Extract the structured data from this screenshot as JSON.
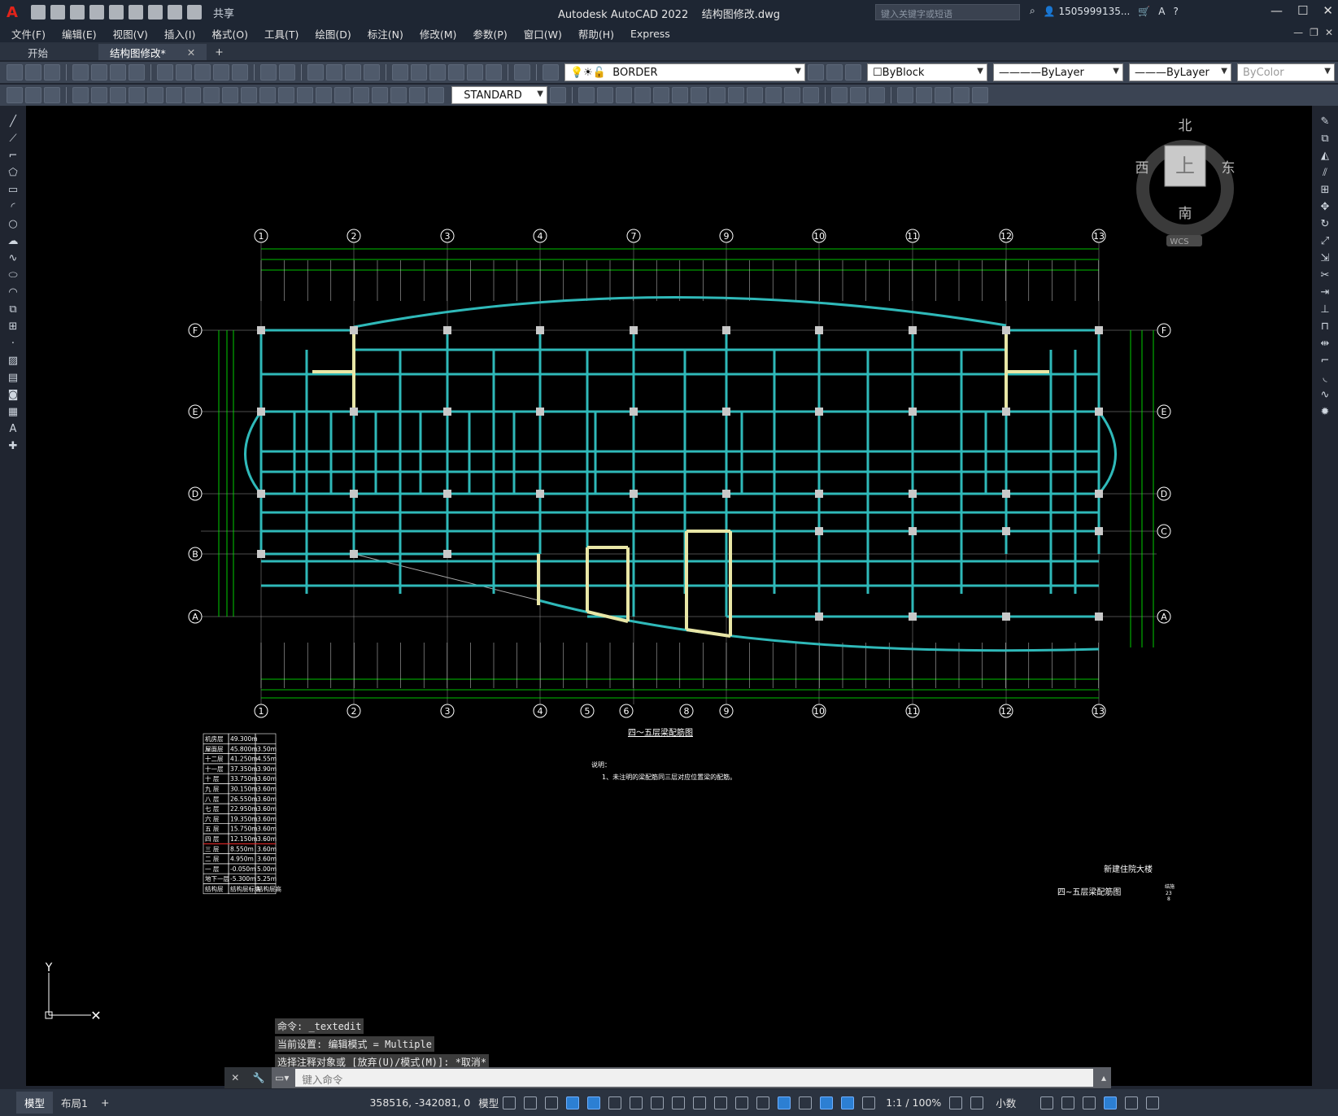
{
  "title": {
    "app_name": "Autodesk AutoCAD 2022",
    "file": "结构图修改.dwg",
    "share": "共享",
    "search_placeholder": "键入关键字或短语",
    "user": "1505999135..."
  },
  "menu": [
    "文件(F)",
    "编辑(E)",
    "视图(V)",
    "插入(I)",
    "格式(O)",
    "工具(T)",
    "绘图(D)",
    "标注(N)",
    "修改(M)",
    "参数(P)",
    "窗口(W)",
    "帮助(H)",
    "Express"
  ],
  "tabs": {
    "start": "开始",
    "active": "结构图修改*",
    "add": "+"
  },
  "toolbar1": {
    "layer": "BORDER",
    "color": "ByBlock",
    "linetype": "ByLayer",
    "lineweight": "ByLayer",
    "plotstyle": "ByColor"
  },
  "toolbar2": {
    "textstyle": "STANDARD"
  },
  "viewcube": {
    "north": "北",
    "south": "南",
    "east": "东",
    "west": "西",
    "top": "上",
    "wcs": "WCS"
  },
  "ucs": {
    "y": "Y"
  },
  "drawing": {
    "top_axes": [
      "1",
      "2",
      "3",
      "4",
      "7",
      "9",
      "10",
      "11",
      "12",
      "13"
    ],
    "bottom_axes": [
      "1",
      "2",
      "3",
      "4",
      "5",
      "6",
      "8",
      "9",
      "10",
      "11",
      "12",
      "13"
    ],
    "left_rows": [
      "F",
      "E",
      "D",
      "B",
      "A"
    ],
    "right_rows": [
      "F",
      "E",
      "D",
      "C",
      "A"
    ],
    "title": "四～五层梁配筋图",
    "note_head": "说明：",
    "note_1": "1、未注明的梁配筋同三层对应位置梁的配筋。",
    "project": "新建住院大楼",
    "sheet": "四~五层梁配筋图",
    "sheet_code": "结施",
    "sheet_no_a": "23",
    "sheet_no_b": "8"
  },
  "floor_table": [
    [
      "机房层",
      "49.300m",
      ""
    ],
    [
      "屋面层",
      "45.800m",
      "3.50m"
    ],
    [
      "十二层",
      "41.250m",
      "4.55m"
    ],
    [
      "十一层",
      "37.350m",
      "3.90m"
    ],
    [
      "十 层",
      "33.750m",
      "3.60m"
    ],
    [
      "九 层",
      "30.150m",
      "3.60m"
    ],
    [
      "八 层",
      "26.550m",
      "3.60m"
    ],
    [
      "七 层",
      "22.950m",
      "3.60m"
    ],
    [
      "六 层",
      "19.350m",
      "3.60m"
    ],
    [
      "五 层",
      "15.750m",
      "3.60m"
    ],
    [
      "四 层",
      "12.150m",
      "3.60m"
    ],
    [
      "三 层",
      "8.550m",
      "3.60m"
    ],
    [
      "二 层",
      "4.950m",
      "3.60m"
    ],
    [
      "一 层",
      "-0.050m",
      "5.00m"
    ],
    [
      "地下一层",
      "-5.300m",
      "5.25m"
    ],
    [
      "结构层",
      "结构层标高",
      "结构层高"
    ]
  ],
  "command": {
    "line1": "命令: _textedit",
    "line2": "当前设置: 编辑模式 = Multiple",
    "line3": "选择注释对象或 [放弃(U)/模式(M)]: *取消*",
    "placeholder": "键入命令"
  },
  "status": {
    "model_tab": "模型",
    "layout_tab": "布局1",
    "coords": "358516, -342081, 0",
    "mode": "模型",
    "scale": "1:1 / 100%",
    "units": "小数"
  },
  "colors": {
    "canvas": "#000000",
    "grid": "#00ff00",
    "beam": "#2fb9b9",
    "highlight": "#e8e6a6",
    "column": "#c8c8c8",
    "chrome": "#202530"
  }
}
